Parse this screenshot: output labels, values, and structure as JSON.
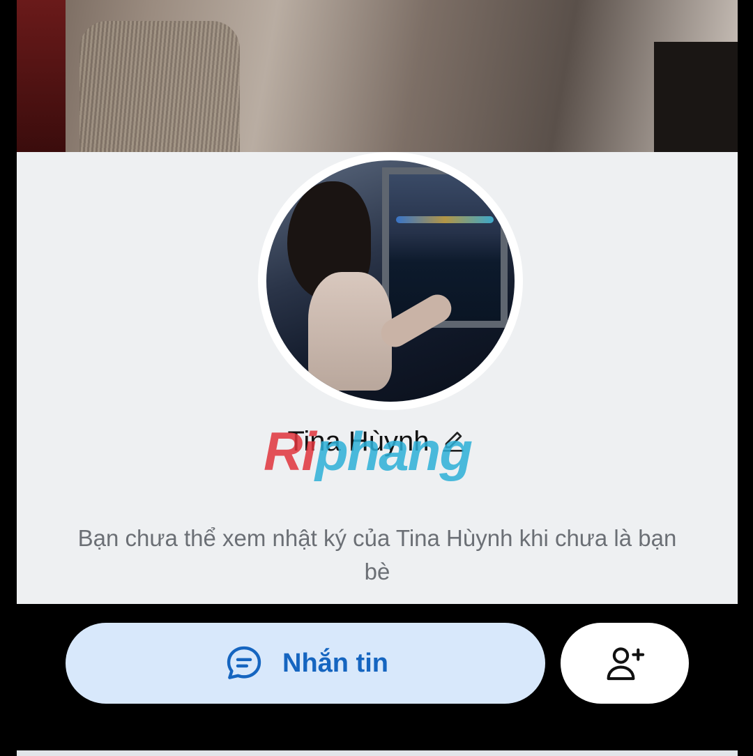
{
  "profile": {
    "name": "Tina Hùynh",
    "watermark_part1": "Ri",
    "watermark_part2": "phang",
    "notice": "Bạn chưa thể xem nhật ký của Tina Hùynh khi chưa là bạn bè"
  },
  "actions": {
    "message_label": "Nhắn tin"
  },
  "icons": {
    "edit": "pencil-icon",
    "message": "chat-bubble-icon",
    "add_friend": "add-user-icon"
  },
  "colors": {
    "accent": "#1565c0",
    "message_button_bg": "#d8e8fb",
    "panel_bg": "#eef0f2",
    "notice_text": "#6b6f75"
  }
}
